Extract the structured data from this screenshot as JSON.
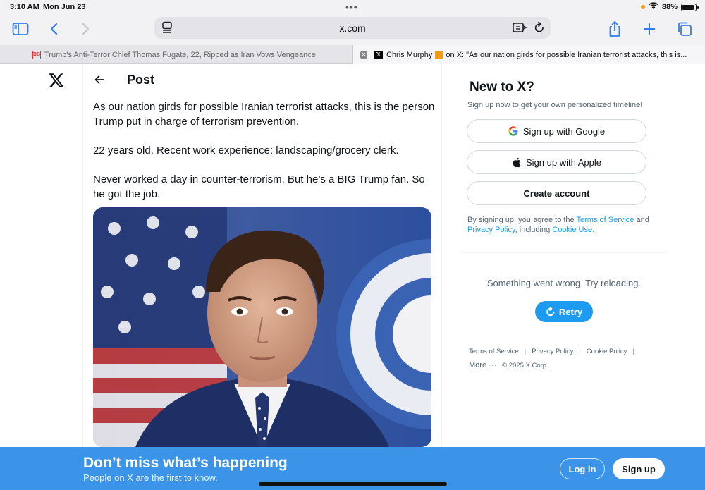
{
  "status": {
    "time": "3:10 AM",
    "date": "Mon Jun 23",
    "battery": "88%",
    "battery_level": 0.88
  },
  "browser": {
    "url": "x.com",
    "tabs": [
      {
        "title": "Trump's Anti-Terror Chief Thomas Fugate, 22, Ripped as Iran Vows Vengeance",
        "favicon_text": "DB",
        "active": false
      },
      {
        "title_prefix": "Chris Murphy",
        "title_suffix": "on X: \"As our nation girds for possible Iranian terrorist attacks, this is...",
        "active": true
      }
    ]
  },
  "post": {
    "header": "Post",
    "paragraphs": [
      "As our nation girds for possible Iranian terrorist attacks, this is the person Trump put in charge of terrorism prevention.",
      "22 years old. Recent work experience: landscaping/grocery clerk.",
      "Never worked a day in counter-terrorism. But he’s a BIG Trump fan. So he got the job."
    ]
  },
  "sidebar": {
    "title": "New to X?",
    "subtitle": "Sign up now to get your own personalized timeline!",
    "google_label": "Sign up with Google",
    "apple_label": "Sign up with Apple",
    "create_label": "Create account",
    "legal_prefix": "By signing up, you agree to the ",
    "terms_link": "Terms of Service",
    "legal_and": " and ",
    "privacy_link": "Privacy Policy",
    "legal_including": ", including ",
    "cookie_link": "Cookie Use.",
    "error_text": "Something went wrong. Try reloading.",
    "retry_label": "Retry"
  },
  "footer": {
    "terms": "Terms of Service",
    "privacy": "Privacy Policy",
    "cookie": "Cookie Policy",
    "more": "More ···",
    "copyright": "© 2025 X Corp."
  },
  "banner": {
    "title": "Don’t miss what’s happening",
    "subtitle": "People on X are the first to know.",
    "login_label": "Log in",
    "signup_label": "Sign up"
  },
  "colors": {
    "accent": "#1d9bf0",
    "banner": "#3b94e8",
    "safari_blue": "#2f7cf6"
  }
}
